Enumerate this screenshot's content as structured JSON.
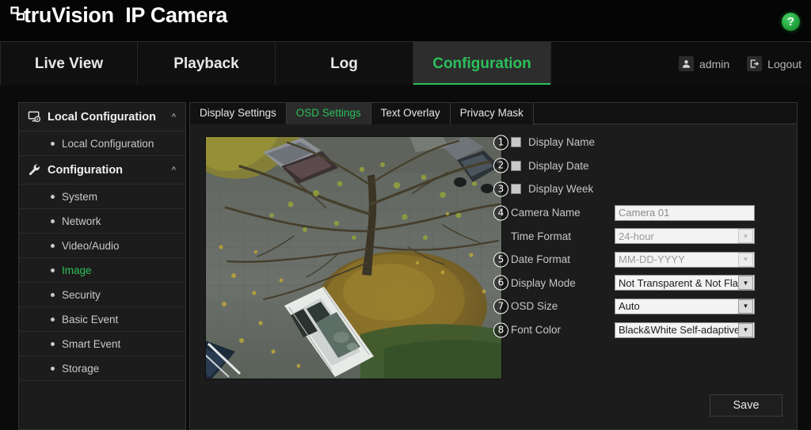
{
  "header": {
    "brand_logo_icon": "link-squares-icon",
    "brand_name": "truVision",
    "brand_product": "IP Camera",
    "help_icon": "?",
    "help_icon_color": "#22a53e"
  },
  "nav": {
    "tabs": [
      {
        "label": "Live View",
        "active": false
      },
      {
        "label": "Playback",
        "active": false
      },
      {
        "label": "Log",
        "active": false
      },
      {
        "label": "Configuration",
        "active": true
      }
    ],
    "active_color": "#2cc05a",
    "user": {
      "icon": "user-icon",
      "label": "admin"
    },
    "logout": {
      "icon": "logout-icon",
      "label": "Logout"
    }
  },
  "sidebar": {
    "groups": [
      {
        "icon": "monitor-config-icon",
        "label": "Local Configuration",
        "chevron": "chevron-up-icon",
        "items": [
          {
            "label": "Local Configuration",
            "active": false
          }
        ]
      },
      {
        "icon": "wrench-icon",
        "label": "Configuration",
        "chevron": "chevron-up-icon",
        "items": [
          {
            "label": "System",
            "active": false
          },
          {
            "label": "Network",
            "active": false
          },
          {
            "label": "Video/Audio",
            "active": false
          },
          {
            "label": "Image",
            "active": true
          },
          {
            "label": "Security",
            "active": false
          },
          {
            "label": "Basic Event",
            "active": false
          },
          {
            "label": "Smart Event",
            "active": false
          },
          {
            "label": "Storage",
            "active": false
          }
        ]
      }
    ],
    "active_color": "#2cc05a"
  },
  "content": {
    "tabs": [
      {
        "label": "Display Settings",
        "active": false
      },
      {
        "label": "OSD Settings",
        "active": true
      },
      {
        "label": "Text Overlay",
        "active": false
      },
      {
        "label": "Privacy Mask",
        "active": false
      }
    ],
    "preview": {
      "name": "live-video-preview",
      "description": "Aerial view of a wet parking lot in autumn with a large bare tree, fallen yellow leaves and several parked cars including a white car"
    },
    "form": {
      "rows": [
        {
          "callout": "1",
          "type": "checkbox",
          "label": "Display Name",
          "checked": false
        },
        {
          "callout": "2",
          "type": "checkbox",
          "label": "Display Date",
          "checked": false
        },
        {
          "callout": "3",
          "type": "checkbox",
          "label": "Display Week",
          "checked": false
        },
        {
          "callout": "4",
          "type": "text",
          "label": "Camera Name",
          "value": "Camera 01",
          "disabled": true
        },
        {
          "callout": "",
          "type": "select",
          "label": "Time Format",
          "value": "24-hour",
          "disabled": true
        },
        {
          "callout": "5",
          "type": "select",
          "label": "Date Format",
          "value": "MM-DD-YYYY",
          "disabled": true
        },
        {
          "callout": "6",
          "type": "select",
          "label": "Display Mode",
          "value": "Not Transparent & Not Flashing",
          "disabled": false
        },
        {
          "callout": "7",
          "type": "select",
          "label": "OSD Size",
          "value": "Auto",
          "disabled": false
        },
        {
          "callout": "8",
          "type": "select",
          "label": "Font Color",
          "value": "Black&White Self-adaptive",
          "disabled": false
        }
      ]
    },
    "save_label": "Save"
  }
}
